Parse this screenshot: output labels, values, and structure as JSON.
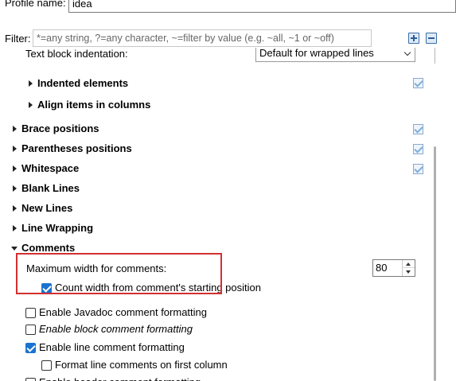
{
  "profile": {
    "label": "Profile name:",
    "value": "idea"
  },
  "filter": {
    "label": "Filter:",
    "placeholder": "*=any string, ?=any character, ~=filter by value (e.g. ~all, ~1 or ~off)",
    "value": ""
  },
  "toolbar": {
    "expand_icon": "plus-square-icon",
    "collapse_icon": "minus-square-icon"
  },
  "tree": {
    "text_block_indentation": {
      "label": "Text block indentation:",
      "value": "Default for wrapped lines"
    },
    "indented_elements": "Indented elements",
    "align_items_in_columns": "Align items in columns",
    "brace_positions": "Brace positions",
    "parentheses_positions": "Parentheses positions",
    "whitespace": "Whitespace",
    "blank_lines": "Blank Lines",
    "new_lines": "New Lines",
    "line_wrapping": "Line Wrapping",
    "comments": "Comments",
    "max_width_for_comments": {
      "label": "Maximum width for comments:",
      "value": "80"
    },
    "count_width_from_start": {
      "label": "Count width from comment's starting position",
      "checked": true
    },
    "enable_javadoc_formatting": {
      "label": "Enable Javadoc comment formatting",
      "checked": false
    },
    "enable_block_comment_formatting": {
      "label": "Enable block comment formatting",
      "checked": false
    },
    "enable_line_comment_formatting": {
      "label": "Enable line comment formatting",
      "checked": true
    },
    "format_line_comments_first_column": {
      "label": "Format line comments on first column",
      "checked": false
    },
    "enable_header_comment_formatting": {
      "label": "Enable header comment formatting",
      "checked": false
    }
  },
  "colors": {
    "highlight_border": "#d32f2f",
    "checkbox_checked": "#1a73d0"
  }
}
